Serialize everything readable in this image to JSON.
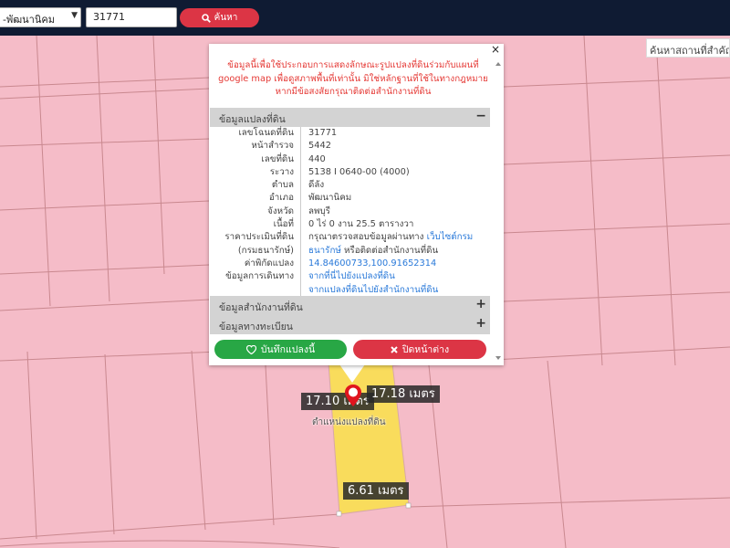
{
  "header": {
    "district_select": "-พัฒนานิคม",
    "search_value": "31771",
    "search_label": "ค้นหา"
  },
  "map": {
    "place_search_placeholder": "ค้นหาสถานที่สำคัญ",
    "measurements": [
      "17.10 เมตร",
      "17.18 เมตร",
      "6.61 เมตร"
    ],
    "parcel_location_label": "ตำแหน่งแปลงที่ดิน",
    "colors": {
      "land": "#f5bcc8",
      "parcel": "#f9dc5c",
      "pin": "#e0141e"
    }
  },
  "popup": {
    "close": "×",
    "disclaimer": "ข้อมูลนี้เพื่อใช้ประกอบการแสดงลักษณะรูปแปลงที่ดินร่วมกับแผนที่ google map เพื่อดูสภาพพื้นที่เท่านั้น มิใช่หลักฐานที่ใช้ในทางกฎหมาย หากมีข้อสงสัยกรุณาติดต่อสำนักงานที่ดิน",
    "sections": {
      "parcel": {
        "title": "ข้อมูลแปลงที่ดิน",
        "toggle": "−"
      },
      "office": {
        "title": "ข้อมูลสำนักงานที่ดิน",
        "toggle": "+"
      },
      "registration": {
        "title": "ข้อมูลทางทะเบียน",
        "toggle": "+"
      }
    },
    "info": {
      "deed_no": {
        "label": "เลขโฉนดที่ดิน",
        "value": "31771"
      },
      "survey_page": {
        "label": "หน้าสำรวจ",
        "value": "5442"
      },
      "land_no": {
        "label": "เลขที่ดิน",
        "value": "440"
      },
      "map_sheet": {
        "label": "ระวาง",
        "value": "5138 I 0640-00 (4000)"
      },
      "subdistrict": {
        "label": "ตำบล",
        "value": "ดีลัง"
      },
      "district": {
        "label": "อำเภอ",
        "value": "พัฒนานิคม"
      },
      "province": {
        "label": "จังหวัด",
        "value": "ลพบุรี"
      },
      "area": {
        "label": "เนื้อที่",
        "value": "0 ไร่ 0 งาน 25.5 ตารางวา"
      },
      "appraisal": {
        "label": "ราคาประเมินที่ดิน",
        "value": "กรุณาตรวจสอบข้อมูลผ่านทาง",
        "link": "เว็บไซต์กรม"
      },
      "appraisal_line2": {
        "label": "(กรมธนารักษ์)",
        "link": "ธนารักษ์",
        "value": "หรือติดต่อสำนักงานที่ดิน"
      },
      "coordinates": {
        "label": "ค่าพิกัดแปลง",
        "value": "14.84600733,100.91652314"
      },
      "directions": {
        "label": "ข้อมูลการเดินทาง",
        "link1": "จากที่นี่ไปยังแปลงที่ดิน",
        "link2": "จากแปลงที่ดินไปยังสำนักงานที่ดิน"
      }
    },
    "buttons": {
      "save": "บันทึกแปลงนี้",
      "close_window": "ปิดหน้าต่าง"
    }
  }
}
